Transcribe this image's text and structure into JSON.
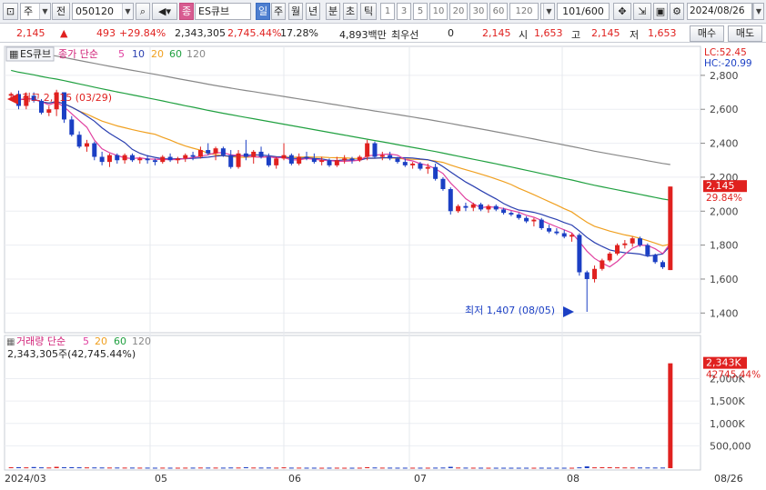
{
  "toolbar": {
    "market": "주",
    "prev_label": "전",
    "code": "050120",
    "name": "ES큐브",
    "periods": [
      "일",
      "주",
      "월",
      "년",
      "분",
      "초",
      "틱"
    ],
    "active_period": "일",
    "minute_units": [
      "1",
      "3",
      "5",
      "10",
      "20",
      "30",
      "60",
      "120"
    ],
    "count": "101/600",
    "date": "2024/08/26"
  },
  "quote": {
    "price": "2,145",
    "change": "493",
    "change_pct": "+29.84%",
    "volume": "2,343,305",
    "volume_ratio": "2,745.44%",
    "turnover": "17.28%",
    "amount": "4,893백만",
    "quote_type": "최우선",
    "quote_value": "0",
    "last": "2,145",
    "open_label": "시",
    "open": "1,653",
    "high_label": "고",
    "high": "2,145",
    "low_label": "저",
    "low": "1,653",
    "buy_label": "매수",
    "sell_label": "매도"
  },
  "price_panel": {
    "title": "ES큐브",
    "legend_prefix": "종가 단순",
    "ma_labels": [
      "5",
      "10",
      "20",
      "60",
      "120"
    ],
    "ma_colors": [
      "#e040a0",
      "#2a3fb0",
      "#f0a020",
      "#20a040",
      "#888888"
    ],
    "lc": "LC:52.45",
    "hc": "HC:-20.99",
    "high_note": "최고 2,715 (03/29)",
    "low_note": "최저 1,407 (08/05)",
    "last_price_tag": "2,145",
    "last_pct_tag": "29.84%"
  },
  "volume_panel": {
    "legend_prefix": "거래량 단순",
    "ma_labels": [
      "5",
      "20",
      "60",
      "120"
    ],
    "ma_colors": [
      "#e040a0",
      "#f0a020",
      "#20a040",
      "#888888"
    ],
    "value_text": "2,343,305주(42,745.44%)",
    "last_tag": "2,343K",
    "pct_tag": "42745.44%"
  },
  "x_axis_labels": [
    "2024/03",
    "05",
    "06",
    "07",
    "08",
    "08/26"
  ],
  "chart_data": {
    "type": "candlestick",
    "price_y_ticks": [
      2800,
      2600,
      2400,
      2200,
      2000,
      1800,
      1600,
      1400
    ],
    "price_ylim": [
      1300,
      2960
    ],
    "volume_y_ticks": [
      "2,000K",
      "1,500K",
      "1,000K",
      "500,000"
    ],
    "volume_ylim": [
      0,
      2600000
    ],
    "candles": [
      [
        2680,
        2700,
        2650,
        2690
      ],
      [
        2690,
        2710,
        2600,
        2620
      ],
      [
        2620,
        2700,
        2600,
        2680
      ],
      [
        2680,
        2700,
        2640,
        2650
      ],
      [
        2650,
        2660,
        2570,
        2580
      ],
      [
        2580,
        2620,
        2560,
        2600
      ],
      [
        2600,
        2715,
        2560,
        2700
      ],
      [
        2700,
        2700,
        2520,
        2540
      ],
      [
        2540,
        2560,
        2440,
        2450
      ],
      [
        2450,
        2470,
        2370,
        2380
      ],
      [
        2380,
        2420,
        2350,
        2400
      ],
      [
        2400,
        2410,
        2300,
        2320
      ],
      [
        2320,
        2350,
        2270,
        2290
      ],
      [
        2290,
        2340,
        2260,
        2330
      ],
      [
        2330,
        2340,
        2280,
        2300
      ],
      [
        2300,
        2340,
        2280,
        2330
      ],
      [
        2330,
        2340,
        2290,
        2300
      ],
      [
        2300,
        2320,
        2280,
        2310
      ],
      [
        2310,
        2330,
        2280,
        2300
      ],
      [
        2300,
        2310,
        2270,
        2290
      ],
      [
        2290,
        2330,
        2280,
        2320
      ],
      [
        2320,
        2340,
        2290,
        2300
      ],
      [
        2300,
        2320,
        2280,
        2310
      ],
      [
        2310,
        2340,
        2290,
        2330
      ],
      [
        2330,
        2350,
        2300,
        2320
      ],
      [
        2320,
        2380,
        2310,
        2360
      ],
      [
        2360,
        2400,
        2330,
        2340
      ],
      [
        2340,
        2380,
        2300,
        2370
      ],
      [
        2370,
        2380,
        2320,
        2330
      ],
      [
        2330,
        2360,
        2250,
        2260
      ],
      [
        2260,
        2360,
        2250,
        2340
      ],
      [
        2340,
        2420,
        2300,
        2320
      ],
      [
        2320,
        2360,
        2280,
        2350
      ],
      [
        2350,
        2380,
        2310,
        2320
      ],
      [
        2320,
        2340,
        2260,
        2270
      ],
      [
        2270,
        2320,
        2250,
        2310
      ],
      [
        2310,
        2400,
        2300,
        2330
      ],
      [
        2330,
        2340,
        2270,
        2280
      ],
      [
        2280,
        2340,
        2270,
        2320
      ],
      [
        2320,
        2350,
        2300,
        2310
      ],
      [
        2310,
        2340,
        2280,
        2290
      ],
      [
        2290,
        2320,
        2270,
        2300
      ],
      [
        2300,
        2310,
        2260,
        2270
      ],
      [
        2270,
        2320,
        2260,
        2300
      ],
      [
        2300,
        2330,
        2280,
        2310
      ],
      [
        2310,
        2320,
        2280,
        2300
      ],
      [
        2300,
        2330,
        2290,
        2320
      ],
      [
        2320,
        2420,
        2300,
        2400
      ],
      [
        2400,
        2410,
        2310,
        2320
      ],
      [
        2320,
        2350,
        2300,
        2330
      ],
      [
        2330,
        2350,
        2300,
        2310
      ],
      [
        2310,
        2320,
        2280,
        2290
      ],
      [
        2290,
        2310,
        2260,
        2270
      ],
      [
        2270,
        2290,
        2250,
        2280
      ],
      [
        2280,
        2290,
        2240,
        2250
      ],
      [
        2250,
        2280,
        2220,
        2260
      ],
      [
        2260,
        2280,
        2180,
        2190
      ],
      [
        2190,
        2200,
        2120,
        2130
      ],
      [
        2130,
        2140,
        1980,
        2000
      ],
      [
        2000,
        2040,
        1990,
        2030
      ],
      [
        2030,
        2050,
        2000,
        2020
      ],
      [
        2020,
        2050,
        2000,
        2040
      ],
      [
        2040,
        2050,
        2000,
        2010
      ],
      [
        2010,
        2040,
        1990,
        2030
      ],
      [
        2030,
        2040,
        2000,
        2010
      ],
      [
        2010,
        2020,
        1980,
        1990
      ],
      [
        1990,
        2000,
        1970,
        1980
      ],
      [
        1980,
        1990,
        1950,
        1960
      ],
      [
        1960,
        1970,
        1930,
        1940
      ],
      [
        1940,
        1960,
        1910,
        1950
      ],
      [
        1950,
        1960,
        1890,
        1900
      ],
      [
        1900,
        1920,
        1870,
        1880
      ],
      [
        1880,
        1900,
        1860,
        1870
      ],
      [
        1870,
        1890,
        1840,
        1850
      ],
      [
        1850,
        1870,
        1820,
        1860
      ],
      [
        1860,
        1870,
        1620,
        1640
      ],
      [
        1640,
        1650,
        1407,
        1600
      ],
      [
        1600,
        1680,
        1580,
        1660
      ],
      [
        1660,
        1720,
        1650,
        1710
      ],
      [
        1710,
        1760,
        1700,
        1750
      ],
      [
        1750,
        1810,
        1740,
        1800
      ],
      [
        1800,
        1830,
        1780,
        1810
      ],
      [
        1810,
        1850,
        1790,
        1840
      ],
      [
        1840,
        1850,
        1790,
        1800
      ],
      [
        1800,
        1810,
        1730,
        1740
      ],
      [
        1740,
        1750,
        1690,
        1700
      ],
      [
        1700,
        1710,
        1660,
        1670
      ],
      [
        1653,
        2145,
        1653,
        2145
      ]
    ],
    "volumes": [
      20000,
      22000,
      18000,
      25000,
      18000,
      15000,
      30000,
      20000,
      22000,
      19000,
      17000,
      16000,
      15000,
      14000,
      14000,
      13000,
      13000,
      12000,
      12000,
      11000,
      12000,
      11000,
      11000,
      12000,
      12000,
      14000,
      13000,
      13000,
      12000,
      15000,
      14000,
      20000,
      14000,
      13000,
      14000,
      12000,
      18000,
      12000,
      12000,
      11000,
      11000,
      10000,
      11000,
      11000,
      10000,
      10000,
      11000,
      22000,
      15000,
      12000,
      12000,
      11000,
      11000,
      11000,
      11000,
      11000,
      12000,
      14000,
      30000,
      14000,
      12000,
      11000,
      11000,
      10000,
      10000,
      10000,
      10000,
      10000,
      10000,
      10000,
      11000,
      10000,
      10000,
      10000,
      10000,
      18000,
      40000,
      18000,
      20000,
      20000,
      18000,
      16000,
      15000,
      15000,
      15000,
      14000,
      14000,
      2343305
    ]
  }
}
